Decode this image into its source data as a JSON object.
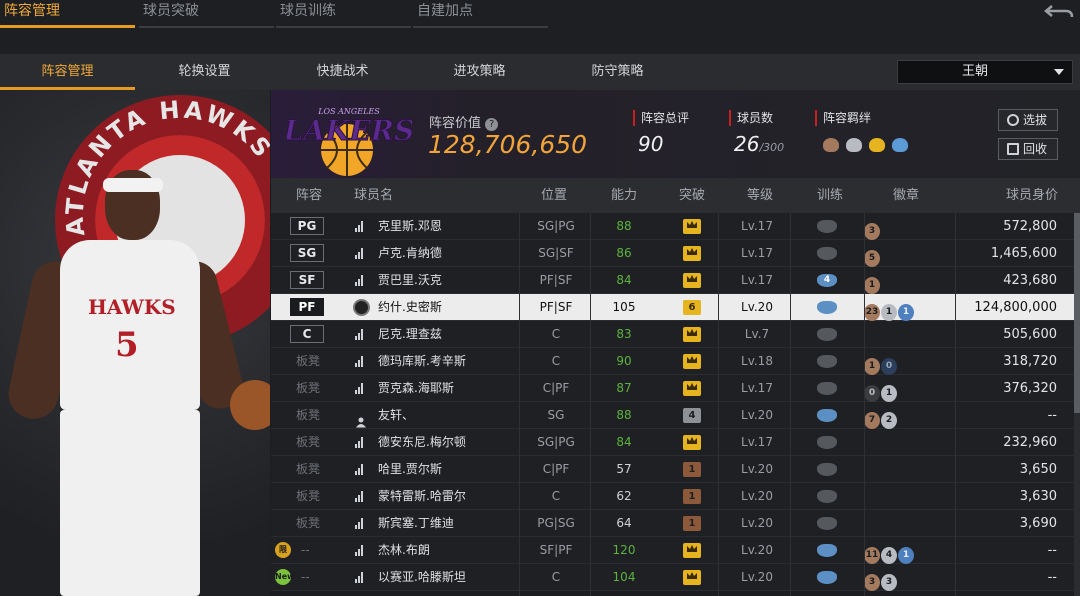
{
  "top_tabs": [
    {
      "label": "阵容管理"
    },
    {
      "label": "球员突破"
    },
    {
      "label": "球员训练"
    },
    {
      "label": "自建加点"
    }
  ],
  "sub_tabs": [
    {
      "label": "阵容管理"
    },
    {
      "label": "轮换设置"
    },
    {
      "label": "快捷战术"
    },
    {
      "label": "进攻策略"
    },
    {
      "label": "防守策略"
    }
  ],
  "team_select": {
    "value": "王朝"
  },
  "header": {
    "value_label": "阵容价值",
    "value": "128,706,650",
    "overall_label": "阵容总评",
    "overall": "90",
    "players_label": "球员数",
    "players": "26",
    "players_max": "/300",
    "synergy_label": "阵容羁绊",
    "btn_select": "选拔",
    "btn_recycle": "回收",
    "logo_top": "LOS ANGELES",
    "logo_text": "LAKERS"
  },
  "columns": {
    "lineup": "阵容",
    "name": "球员名",
    "pos": "位置",
    "ability": "能力",
    "breakthrough": "突破",
    "level": "等级",
    "training": "训练",
    "badge": "徽章",
    "salary": "球员身价"
  },
  "left_panel": {
    "jersey_text": "HAWKS",
    "jersey_number": "5",
    "ring_text": "ATLANTA HAWKS"
  },
  "rows": [
    {
      "slot": "PG",
      "name": "克里斯.邓恩",
      "pos": "SG|PG",
      "ability": "88",
      "ab_color": "g",
      "brk": "crown",
      "brk_type": "gold",
      "lv": "Lv.17",
      "train": "",
      "train_type": "gray",
      "badges": [
        {
          "t": "b",
          "v": "3"
        }
      ],
      "salary": "572,800"
    },
    {
      "slot": "SG",
      "name": "卢克.肯纳德",
      "pos": "SG|SF",
      "ability": "86",
      "ab_color": "g",
      "brk": "crown",
      "brk_type": "gold",
      "lv": "Lv.17",
      "train": "",
      "train_type": "gray",
      "badges": [
        {
          "t": "b",
          "v": "5"
        }
      ],
      "salary": "1,465,600"
    },
    {
      "slot": "SF",
      "name": "贾巴里.沃克",
      "pos": "PF|SF",
      "ability": "84",
      "ab_color": "g",
      "brk": "crown",
      "brk_type": "gold",
      "lv": "Lv.17",
      "train": "4",
      "train_type": "blue",
      "badges": [
        {
          "t": "b",
          "v": "1"
        }
      ],
      "salary": "423,680"
    },
    {
      "slot": "PF",
      "name": "约什.史密斯",
      "pos": "PF|SF",
      "ability": "105",
      "ab_color": "w",
      "brk": "6",
      "brk_type": "gold",
      "lv": "Lv.20",
      "train": "",
      "train_type": "blue",
      "badges": [
        {
          "t": "b",
          "v": "23"
        },
        {
          "t": "s",
          "v": "1"
        },
        {
          "t": "u",
          "v": "1"
        }
      ],
      "salary": "124,800,000",
      "selected": true,
      "icon": "avatar"
    },
    {
      "slot": "C",
      "name": "尼克.理查兹",
      "pos": "C",
      "ability": "83",
      "ab_color": "g",
      "brk": "crown",
      "brk_type": "gold",
      "lv": "Lv.7",
      "train": "",
      "train_type": "gray",
      "badges": [],
      "salary": "505,600"
    },
    {
      "slot": "板凳",
      "name": "德玛库斯.考辛斯",
      "pos": "C",
      "ability": "90",
      "ab_color": "g",
      "brk": "crown",
      "brk_type": "gold",
      "lv": "Lv.18",
      "train": "",
      "train_type": "gray",
      "badges": [
        {
          "t": "b",
          "v": "1"
        },
        {
          "t": "d",
          "v": "0"
        }
      ],
      "salary": "318,720"
    },
    {
      "slot": "板凳",
      "name": "贾克森.海耶斯",
      "pos": "C|PF",
      "ability": "87",
      "ab_color": "g",
      "brk": "crown",
      "brk_type": "gold",
      "lv": "Lv.17",
      "train": "",
      "train_type": "gray",
      "badges": [
        {
          "t": "k",
          "v": "0"
        },
        {
          "t": "s",
          "v": "1"
        }
      ],
      "salary": "376,320"
    },
    {
      "slot": "板凳",
      "name": "友轩、",
      "pos": "SG",
      "ability": "88",
      "ab_color": "g",
      "brk": "4",
      "brk_type": "silv",
      "lv": "Lv.20",
      "train": "",
      "train_type": "blue",
      "badges": [
        {
          "t": "b",
          "v": "7"
        },
        {
          "t": "s",
          "v": "2"
        }
      ],
      "salary": "--",
      "icon": "person"
    },
    {
      "slot": "板凳",
      "name": "德安东尼.梅尔顿",
      "pos": "SG|PG",
      "ability": "84",
      "ab_color": "g",
      "brk": "crown",
      "brk_type": "gold",
      "lv": "Lv.17",
      "train": "",
      "train_type": "gray",
      "badges": [],
      "salary": "232,960"
    },
    {
      "slot": "板凳",
      "name": "哈里.贾尔斯",
      "pos": "C|PF",
      "ability": "57",
      "ab_color": "w",
      "brk": "1",
      "brk_type": "brz",
      "lv": "Lv.20",
      "train": "",
      "train_type": "gray",
      "badges": [],
      "salary": "3,650"
    },
    {
      "slot": "板凳",
      "name": "蒙特雷斯.哈雷尔",
      "pos": "C",
      "ability": "62",
      "ab_color": "w",
      "brk": "1",
      "brk_type": "brz",
      "lv": "Lv.20",
      "train": "",
      "train_type": "gray",
      "badges": [],
      "salary": "3,630"
    },
    {
      "slot": "板凳",
      "name": "斯宾塞.丁维迪",
      "pos": "PG|SG",
      "ability": "64",
      "ab_color": "w",
      "brk": "1",
      "brk_type": "brz",
      "lv": "Lv.20",
      "train": "",
      "train_type": "gray",
      "badges": [],
      "salary": "3,690"
    },
    {
      "slot": "--",
      "name": "杰林.布朗",
      "pos": "SF|PF",
      "ability": "120",
      "ab_color": "g",
      "brk": "crown",
      "brk_type": "gold",
      "lv": "Lv.20",
      "train": "",
      "train_type": "blue",
      "badges": [
        {
          "t": "b",
          "v": "11"
        },
        {
          "t": "s",
          "v": "4"
        },
        {
          "t": "u",
          "v": "1"
        }
      ],
      "salary": "--",
      "tag": "限"
    },
    {
      "slot": "--",
      "name": "以赛亚.哈滕斯坦",
      "pos": "C",
      "ability": "104",
      "ab_color": "g",
      "brk": "crown",
      "brk_type": "gold",
      "lv": "Lv.20",
      "train": "",
      "train_type": "blue",
      "badges": [
        {
          "t": "b",
          "v": "3"
        },
        {
          "t": "s",
          "v": "3"
        }
      ],
      "salary": "--",
      "tag": "New"
    }
  ],
  "colors": {
    "accent": "#e59a22",
    "value": "#f2a43a",
    "green": "#5cb23e"
  }
}
